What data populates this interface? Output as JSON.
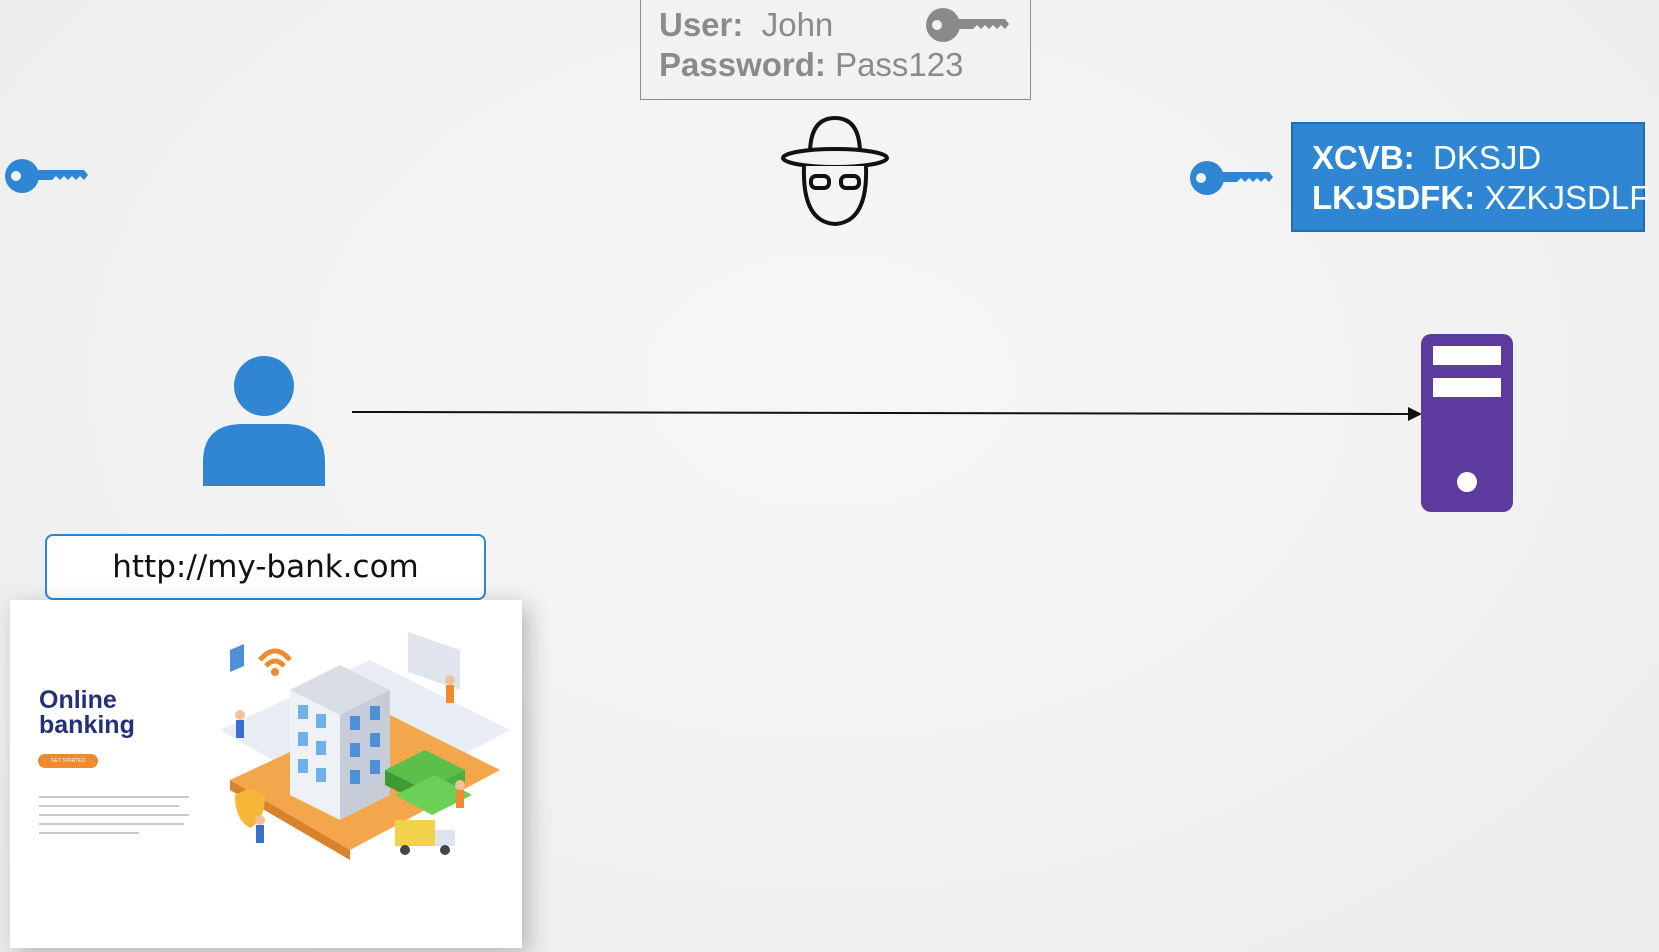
{
  "intercepted_credentials": {
    "user_label": "User:",
    "user_value": "John",
    "password_label": "Password:",
    "password_value": "Pass123"
  },
  "encrypted_credentials": {
    "line1_label": "XCVB:",
    "line1_value": "DKSJD",
    "line2_label": "LKJSDFK:",
    "line2_value": "XZKJSDLF"
  },
  "browser": {
    "url": "http://my-bank.com"
  },
  "website_preview": {
    "heading_line1": "Online",
    "heading_line2": "banking",
    "cta_label": "GET STARTED"
  },
  "icons": {
    "key_left": "key-icon",
    "key_right": "key-icon",
    "key_gray": "key-icon",
    "hacker": "hacker-icon",
    "user": "user-icon",
    "server": "server-icon"
  },
  "colors": {
    "key_blue": "#2f86d2",
    "key_gray": "#8a8a8a",
    "encrypted_box_bg": "#2f86d2",
    "server_purple": "#5c3a9e",
    "user_blue": "#2f86d2"
  }
}
